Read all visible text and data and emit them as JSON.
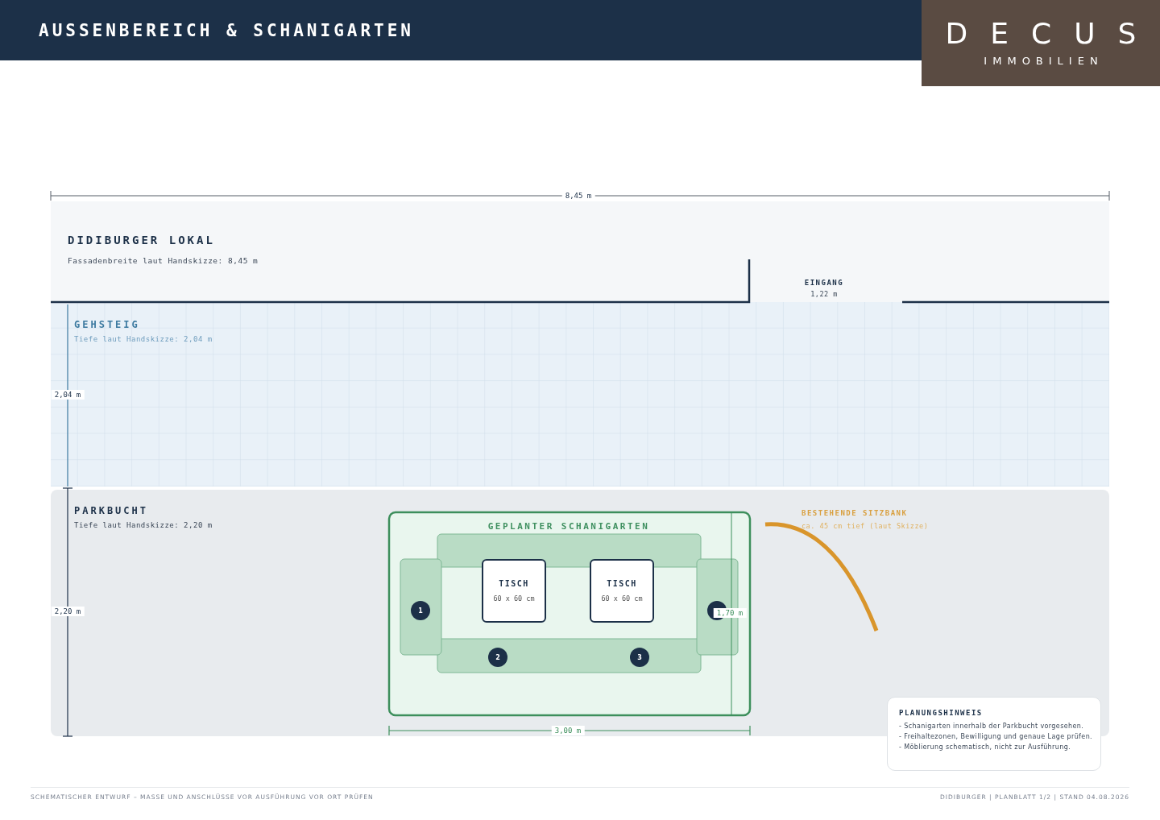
{
  "header": {
    "title": "AUSSENBEREICH & SCHANIGARTEN"
  },
  "logo": {
    "name": "DECUS",
    "subtitle": "IMMOBILIEN"
  },
  "plan": {
    "overall_width": "8,45 m",
    "building": {
      "title": "DIDIBURGER LOKAL",
      "note": "Fassadenbreite laut Handskizze: 8,45 m"
    },
    "entrance": {
      "label": "EINGANG",
      "width": "1,22 m"
    },
    "sidewalk": {
      "title": "GEHSTEIG",
      "note": "Tiefe laut Handskizze: 2,04 m",
      "depth": "2,04 m"
    },
    "parking_bay": {
      "title": "PARKBUCHT",
      "note": "Tiefe laut Handskizze: 2,20 m",
      "depth": "2,20 m"
    },
    "beer_garden": {
      "title": "GEPLANTER SCHANIGARTEN",
      "width": "3,00 m",
      "depth": "1,70 m",
      "tables": [
        {
          "label": "TISCH",
          "size": "60 x 60 cm"
        },
        {
          "label": "TISCH",
          "size": "60 x 60 cm"
        }
      ],
      "seats": [
        {
          "number": "1"
        },
        {
          "number": "2"
        },
        {
          "number": "3"
        }
      ]
    },
    "bench": {
      "title": "BESTEHENDE SITZBANK",
      "note": "ca. 45 cm tief (laut Skizze)"
    },
    "planning_note": {
      "title": "PLANUNGSHINWEIS",
      "items": [
        "- Schanigarten innerhalb der Parkbucht vorgesehen.",
        "- Freihaltezonen, Bewilligung und genaue Lage prüfen.",
        "- Möblierung schematisch, nicht zur Ausführung."
      ]
    }
  },
  "footer": {
    "left": "SCHEMATISCHER ENTWURF – MASSE UND ANSCHLÜSSE VOR AUSFÜHRUNG VOR ORT PRÜFEN",
    "right": "DIDIBURGER | PLANBLATT 1/2 | STAND 04.08.2026"
  }
}
